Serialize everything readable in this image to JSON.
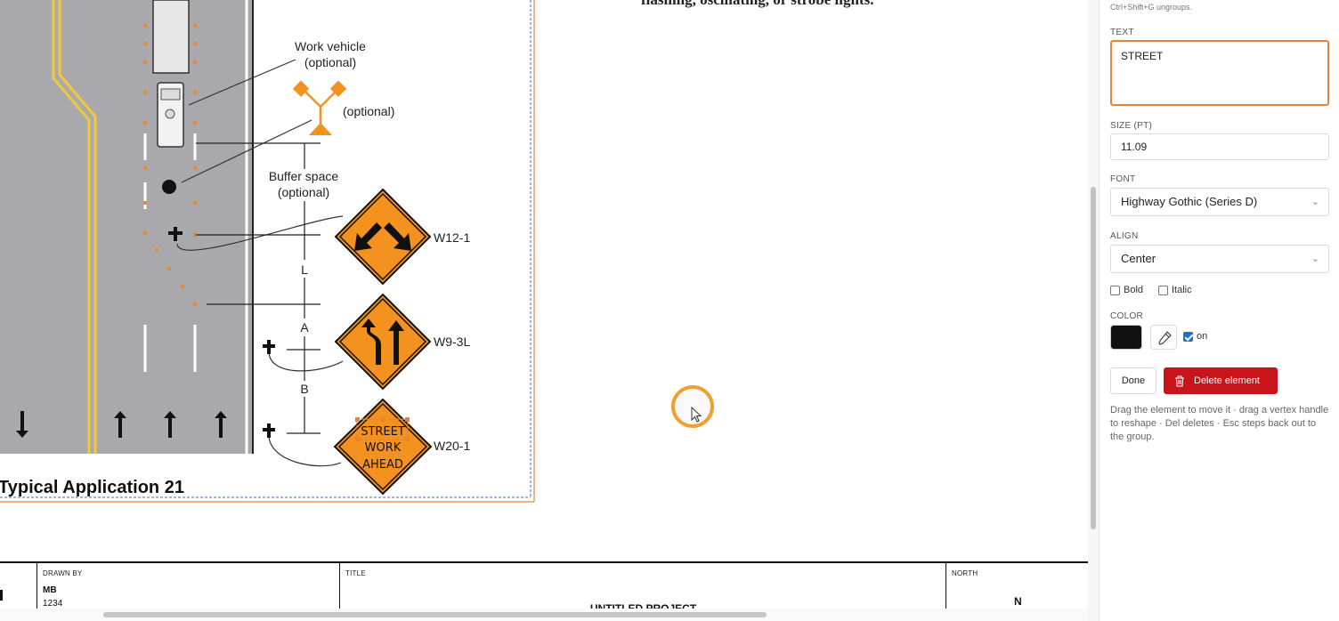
{
  "canvas": {
    "doc_snippet": "flashing, oscillating, or strobe lights.",
    "labels": {
      "work_vehicle": [
        "Work vehicle",
        "(optional)"
      ],
      "optional": "(optional)",
      "buffer_space": [
        "Buffer space",
        "(optional)"
      ],
      "dim_L": "L",
      "dim_A": "A",
      "dim_B": "B",
      "sign_w12": "W12-1",
      "sign_w9": "W9-3L",
      "sign_w20": "W20-1",
      "typical_application": "Typical Application 21"
    },
    "sign_text": [
      "STREET",
      "WORK",
      "AHEAD"
    ],
    "colors": {
      "road": "#a9a9ad",
      "sign_orange": "#f4921f",
      "cone_orange": "#e58a2a",
      "selection_orange": "#e8833a",
      "yellow_line": "#f0c93a"
    }
  },
  "title_block": {
    "drawn_by_label": "DRAWN BY",
    "drawn_by_name": "MB",
    "drawn_by_id": "1234",
    "title_label": "TITLE",
    "title_value": "UNTITLED PROJECT",
    "north_label": "NORTH",
    "north_value": "N"
  },
  "panel": {
    "hint_top": "Ctrl+Shift+G ungroups.",
    "text_label": "TEXT",
    "text_value": "STREET",
    "size_label": "SIZE (PT)",
    "size_value": "11.09",
    "font_label": "FONT",
    "font_value": "Highway Gothic (Series D)",
    "align_label": "ALIGN",
    "align_value": "Center",
    "bold_label": "Bold",
    "italic_label": "Italic",
    "color_label": "COLOR",
    "color_value": "#111111",
    "color_on_label": "on",
    "done_label": "Done",
    "delete_label": "Delete element",
    "help": "Drag the element to move it · drag a vertex handle to reshape · Del deletes · Esc steps back out to the group."
  }
}
